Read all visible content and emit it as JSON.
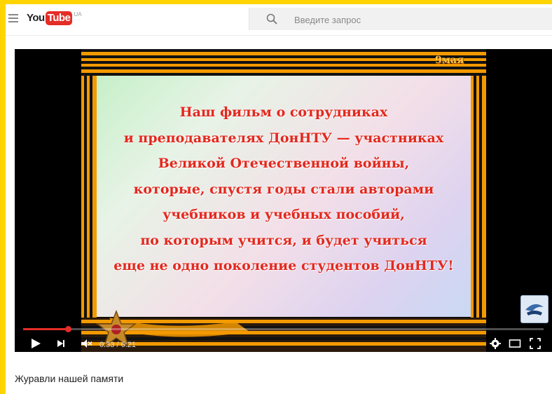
{
  "header": {
    "logo_you": "You",
    "logo_tube": "Tube",
    "logo_region": "UA",
    "search_placeholder": "Введите запрос"
  },
  "player": {
    "slide_badge": "9мая",
    "slide_lines": [
      "Наш фильм о сотрудниках",
      "и преподавателях ДонНТУ — участниках",
      "Великой Отечественной войны,",
      "которые, спустя годы стали авторами",
      "учебников и учебных пособий,",
      "по которым учится, и будет учиться",
      "еще не одно поколение студентов ДонНТУ!"
    ],
    "time_current": "0:33",
    "time_total": "6:21",
    "time_label": "0:33 / 6:21",
    "progress_fraction": 0.0866,
    "muted": true
  },
  "video": {
    "title": "Журавли нашей памяти"
  },
  "colors": {
    "accent": "#e52d27",
    "page_border": "#ffd400",
    "slide_text": "#e3281e"
  }
}
